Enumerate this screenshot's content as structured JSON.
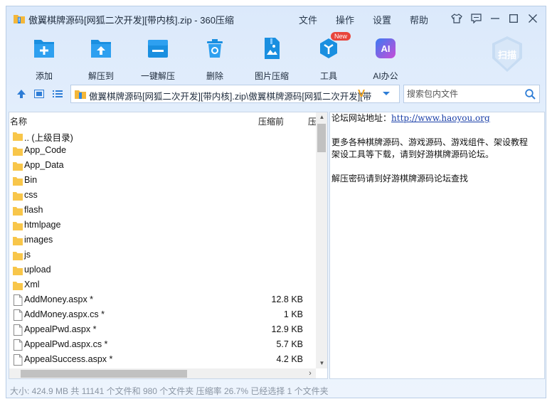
{
  "window": {
    "title": "傲翼棋牌源码[网狐二次开发][带内核].zip - 360压缩",
    "menus": [
      "文件",
      "操作",
      "设置",
      "帮助"
    ]
  },
  "toolbar": {
    "items": [
      {
        "label": "添加",
        "icon": "add-icon"
      },
      {
        "label": "解压到",
        "icon": "extract-to-icon"
      },
      {
        "label": "一键解压",
        "icon": "one-click-extract-icon"
      },
      {
        "label": "删除",
        "icon": "trash-icon"
      },
      {
        "label": "图片压缩",
        "icon": "image-compress-icon"
      },
      {
        "label": "工具",
        "icon": "tools-icon",
        "badge": "New"
      },
      {
        "label": "AI办公",
        "icon": "ai-icon",
        "icon_text": "AI"
      }
    ],
    "scan_label": "扫描"
  },
  "address": {
    "path": "傲翼棋牌源码[网狐二次开发][带内核].zip\\傲翼棋牌源码[网狐二次开发][带",
    "search_placeholder": "搜索包内文件"
  },
  "columns": {
    "name": "名称",
    "before": "压缩前",
    "after": "压"
  },
  "files": [
    {
      "name": ".. (上级目录)",
      "type": "folder",
      "size": ""
    },
    {
      "name": "App_Code",
      "type": "folder",
      "size": ""
    },
    {
      "name": "App_Data",
      "type": "folder",
      "size": ""
    },
    {
      "name": "Bin",
      "type": "folder",
      "size": ""
    },
    {
      "name": "css",
      "type": "folder",
      "size": ""
    },
    {
      "name": "flash",
      "type": "folder",
      "size": ""
    },
    {
      "name": "htmlpage",
      "type": "folder",
      "size": ""
    },
    {
      "name": "images",
      "type": "folder",
      "size": ""
    },
    {
      "name": "js",
      "type": "folder",
      "size": ""
    },
    {
      "name": "upload",
      "type": "folder",
      "size": ""
    },
    {
      "name": "Xml",
      "type": "folder",
      "size": ""
    },
    {
      "name": "AddMoney.aspx *",
      "type": "file",
      "size": "12.8 KB"
    },
    {
      "name": "AddMoney.aspx.cs *",
      "type": "file",
      "size": "1 KB"
    },
    {
      "name": "AppealPwd.aspx *",
      "type": "file",
      "size": "12.9 KB"
    },
    {
      "name": "AppealPwd.aspx.cs *",
      "type": "file",
      "size": "5.7 KB"
    },
    {
      "name": "AppealSuccess.aspx *",
      "type": "file",
      "size": "4.2 KB"
    }
  ],
  "info": {
    "line1_label": "论坛网站地址：",
    "line1_link": "http://www.haoyou.org",
    "line2": "更多各种棋牌源码、游戏源码、游戏组件、架设教程",
    "line3": "架设工具等下载，请到好游棋牌源码论坛。",
    "line4": "解压密码请到好游棋牌源码论坛查找"
  },
  "status": "大小: 424.9 MB 共 11141 个文件和 980 个文件夹 压缩率 26.7% 已经选择 1 个文件夹",
  "colors": {
    "accent": "#1a8fe0",
    "folder": "#f8c64a",
    "ai_gradient_start": "#3b7bf2",
    "ai_gradient_end": "#c84cd8"
  }
}
